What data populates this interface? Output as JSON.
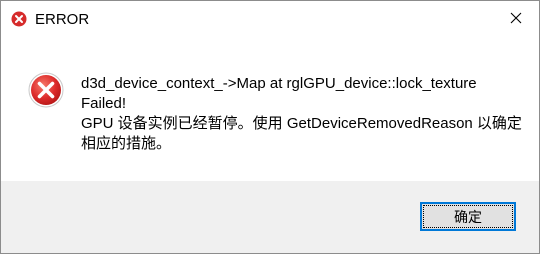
{
  "window": {
    "title": "ERROR"
  },
  "message": {
    "line1": "d3d_device_context_->Map at rglGPU_device::lock_texture",
    "line2": "Failed!",
    "line3": "GPU 设备实例已经暂停。使用 GetDeviceRemovedReason 以确定",
    "line4": "相应的措施。"
  },
  "buttons": {
    "ok_label": "确定"
  },
  "icons": {
    "title": "error-icon",
    "close": "close-icon",
    "message": "error-icon"
  },
  "colors": {
    "error_red": "#e23b3b",
    "focus_border": "#0078d7",
    "footer_bg": "#f0f0f0"
  }
}
